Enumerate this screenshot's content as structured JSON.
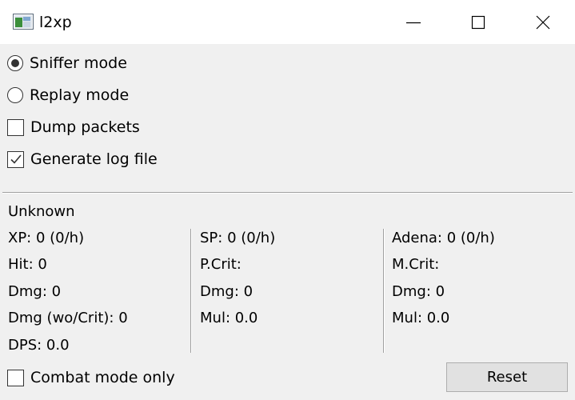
{
  "window": {
    "title": "l2xp",
    "icon": "app-window-icon",
    "controls": [
      "minimize-icon",
      "maximize-icon",
      "close-icon"
    ]
  },
  "options": {
    "sniffer_mode": {
      "label": "Sniffer mode",
      "checked": true
    },
    "replay_mode": {
      "label": "Replay mode",
      "checked": false
    },
    "dump_packets": {
      "label": "Dump packets",
      "checked": false
    },
    "generate_log": {
      "label": "Generate log file",
      "checked": true
    }
  },
  "stats": {
    "status": "Unknown",
    "col1": {
      "xp": "XP: 0 (0/h)",
      "hit": "Hit: 0",
      "dmg": "Dmg: 0",
      "dmg_wo_crit": "Dmg (wo/Crit): 0",
      "dps": "DPS: 0.0"
    },
    "col2": {
      "sp": "SP: 0 (0/h)",
      "pcrit": "P.Crit:",
      "dmg": "Dmg: 0",
      "mul": "Mul: 0.0"
    },
    "col3": {
      "adena": "Adena: 0 (0/h)",
      "mcrit": "M.Crit:",
      "dmg": "Dmg: 0",
      "mul": "Mul: 0.0"
    }
  },
  "footer": {
    "combat_mode": {
      "label": "Combat mode only",
      "checked": false
    },
    "reset_label": "Reset"
  }
}
